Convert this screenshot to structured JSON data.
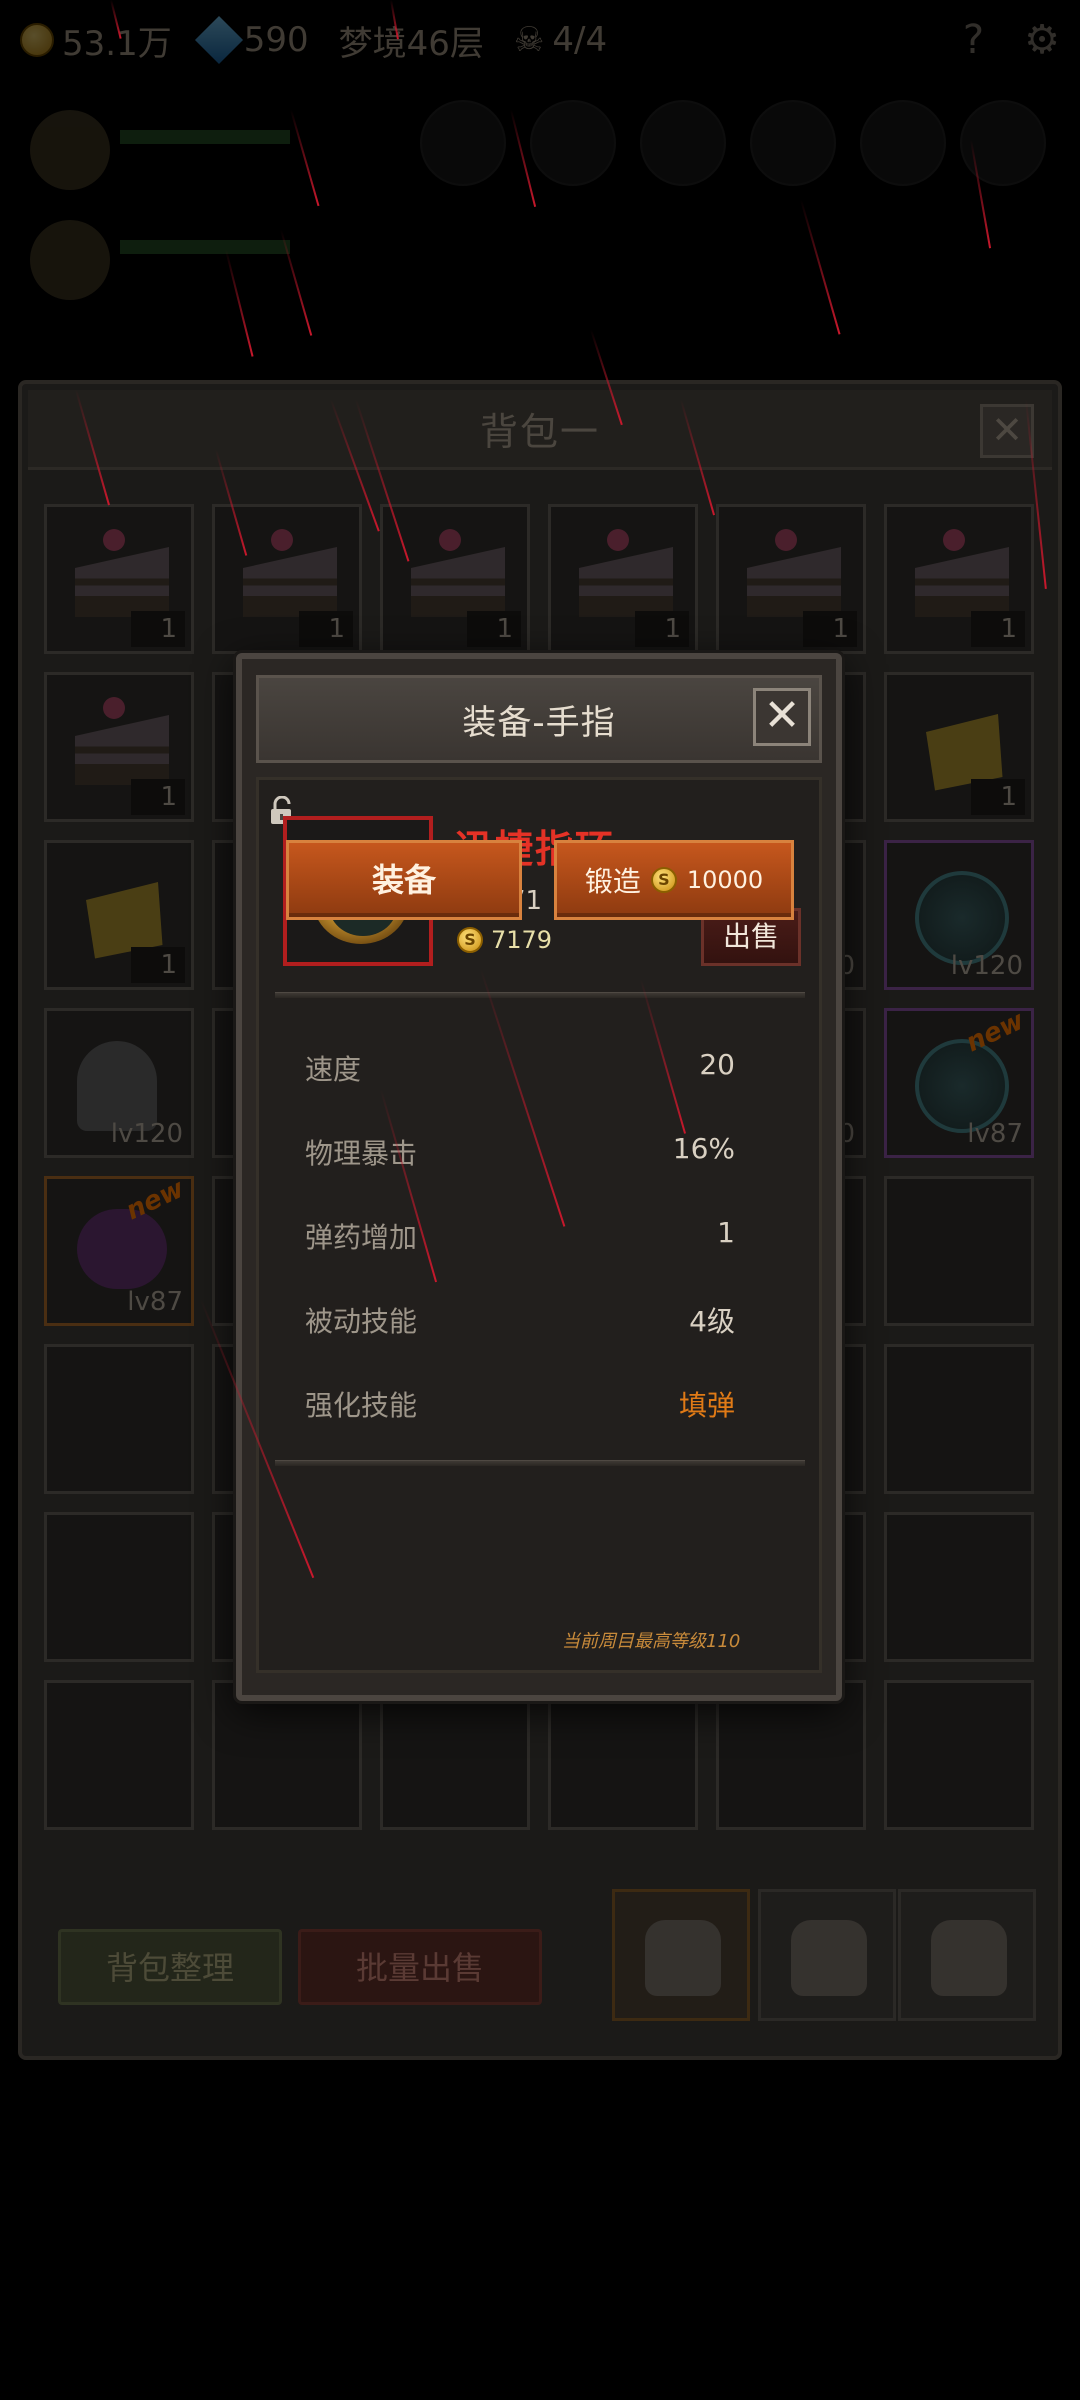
{
  "topbar": {
    "gold": "53.1万",
    "gems": "590",
    "stage": "梦境46层",
    "keys": "4/4",
    "help_icon": "question-icon",
    "settings_icon": "gear-icon"
  },
  "backpack": {
    "title": "背包一",
    "close_label": "✕",
    "rows": [
      [
        {
          "type": "cake",
          "count": "1"
        },
        {
          "type": "cake",
          "count": "1"
        },
        {
          "type": "cake",
          "count": "1"
        },
        {
          "type": "cake",
          "count": "1"
        },
        {
          "type": "cake",
          "count": "1"
        },
        {
          "type": "cake",
          "count": "1"
        }
      ],
      [
        {
          "type": "cake",
          "count": "1"
        },
        {
          "type": "hidden"
        },
        {
          "type": "hidden"
        },
        {
          "type": "hidden"
        },
        {
          "type": "hidden"
        },
        {
          "type": "cheese",
          "count": "1"
        }
      ],
      [
        {
          "type": "cheese",
          "count": "1"
        },
        {
          "type": "hidden"
        },
        {
          "type": "hidden"
        },
        {
          "type": "hidden"
        },
        {
          "type": "hidden",
          "lv": "0"
        },
        {
          "type": "globe",
          "lv": "lv120"
        }
      ],
      [
        {
          "type": "helmet",
          "lv": "lv120"
        },
        {
          "type": "hidden"
        },
        {
          "type": "hidden"
        },
        {
          "type": "hidden"
        },
        {
          "type": "hidden",
          "lv": "20"
        },
        {
          "type": "globe",
          "lv": "lv87",
          "new": "new"
        }
      ],
      [
        {
          "type": "mask",
          "lv": "lv87",
          "new": "new"
        },
        {
          "type": "hidden"
        },
        {
          "type": "hidden"
        },
        {
          "type": "hidden"
        },
        {
          "type": "hidden"
        },
        {
          "type": "empty"
        }
      ]
    ],
    "sort_label": "背包整理",
    "bulk_sell_label": "批量出售"
  },
  "modal": {
    "title": "装备-手指",
    "close_label": "✕",
    "item": {
      "name": "迅捷指环",
      "level": "等级71",
      "price": "7179",
      "coin_symbol": "S",
      "sell_label": "出售"
    },
    "stats": [
      {
        "key": "速度",
        "value": "20"
      },
      {
        "key": "物理暴击",
        "value": "16%"
      },
      {
        "key": "弹药增加",
        "value": "1"
      },
      {
        "key": "被动技能",
        "value": "4级"
      },
      {
        "key": "强化技能",
        "value": "填弹"
      }
    ],
    "equip_label": "装备",
    "forge_label": "锻造",
    "forge_cost": "10000",
    "max_level_note": "当前周目最高等级110"
  },
  "colors": {
    "item_name": "#e53226",
    "highlight_value": "#e07a16",
    "action_button": "#c6571d",
    "rarity_red": "#b21e1e"
  }
}
